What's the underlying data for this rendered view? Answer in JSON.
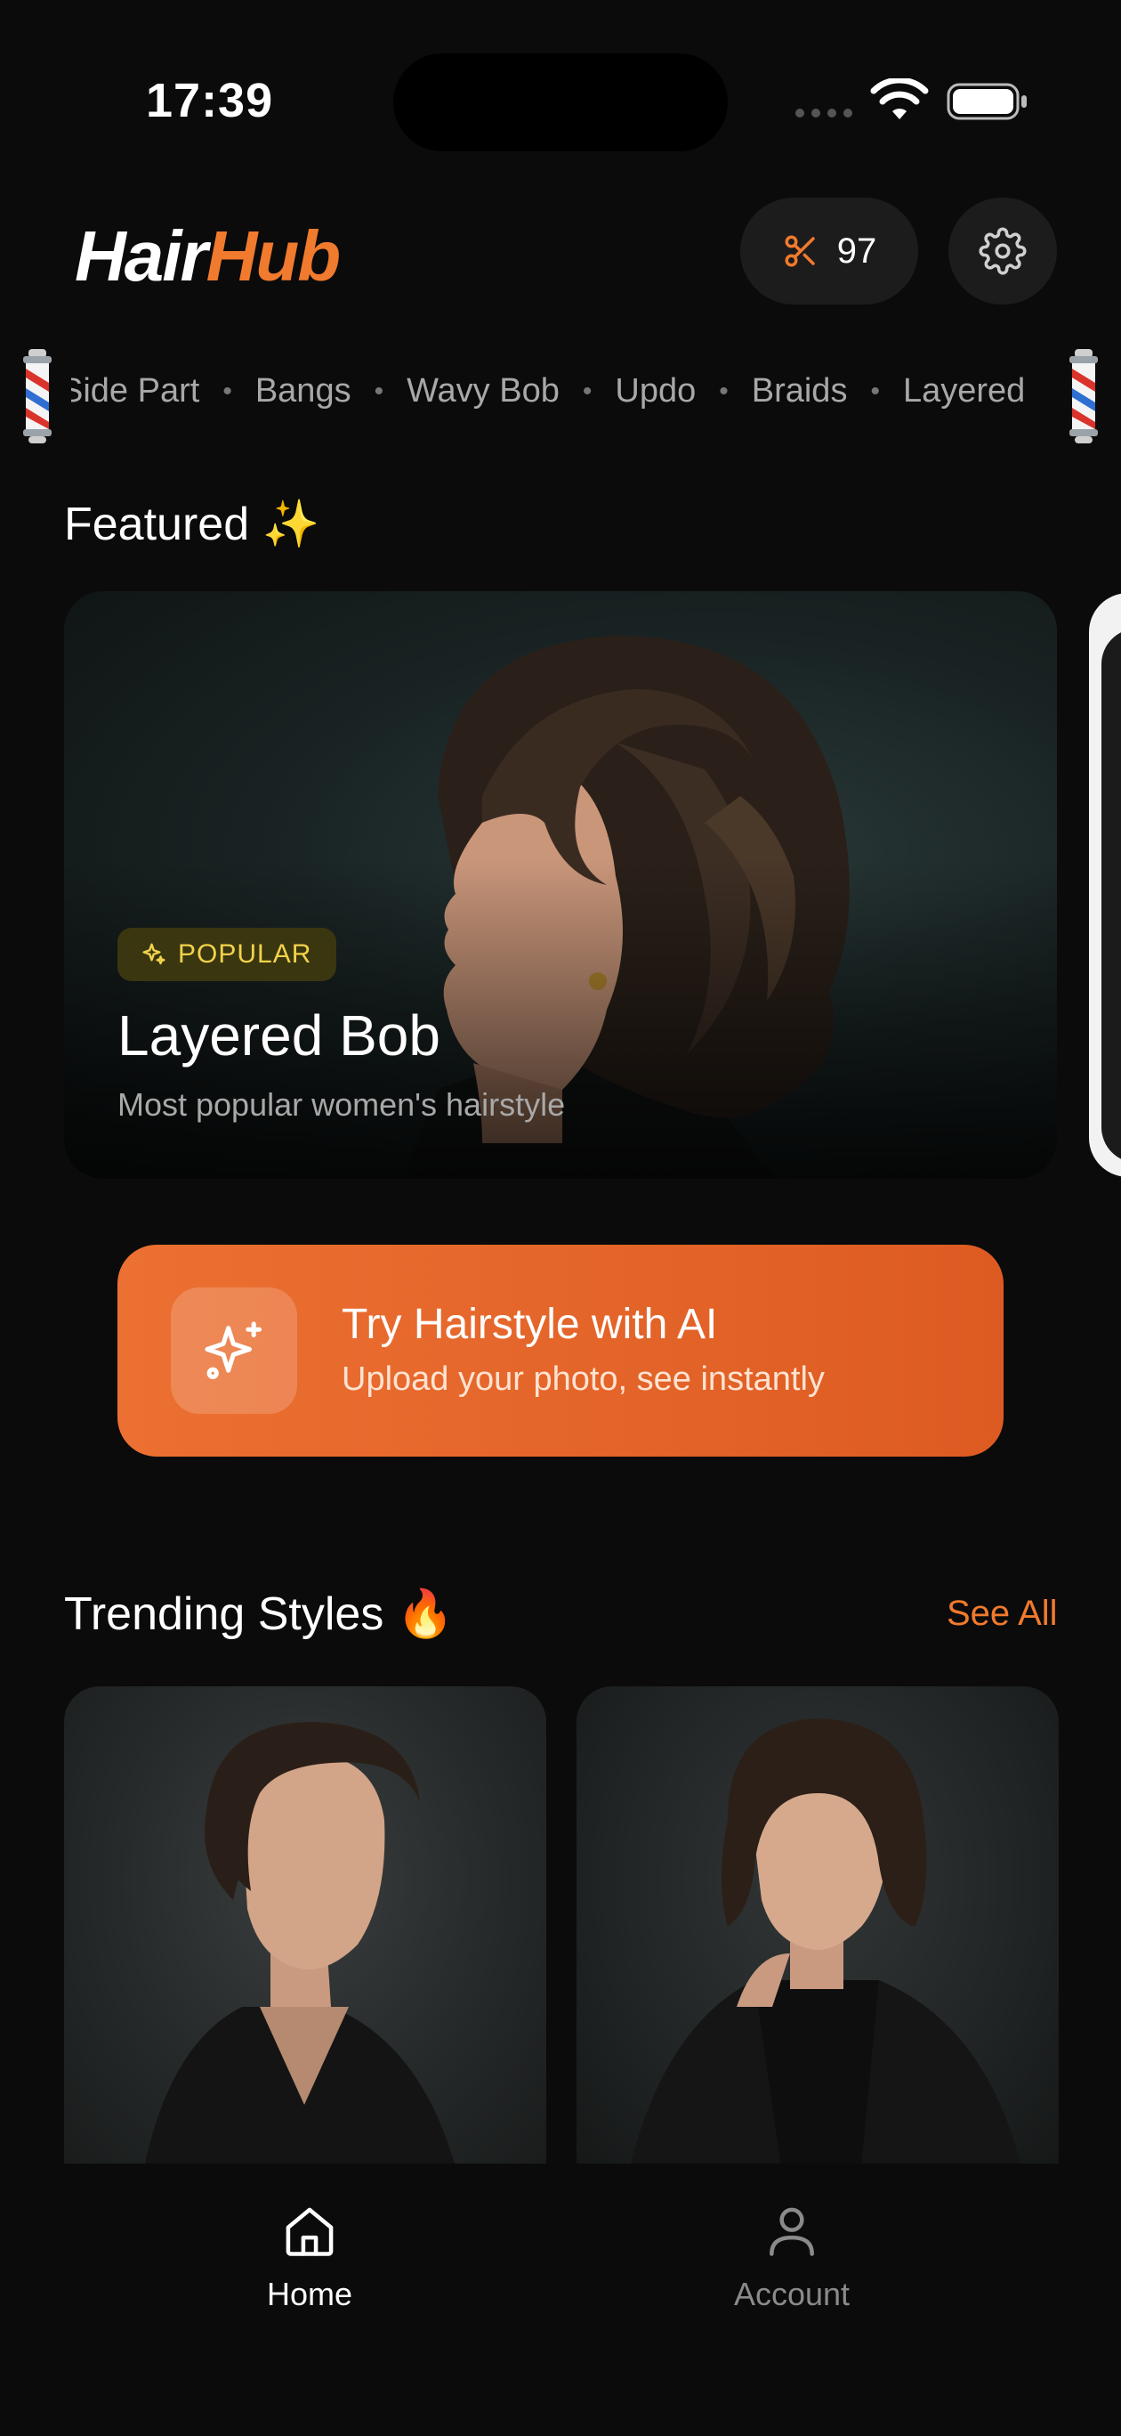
{
  "status_bar": {
    "time": "17:39"
  },
  "header": {
    "logo_part1": "Hair",
    "logo_part2": "Hub",
    "credits_count": "97",
    "accent_color": "#f07a2d"
  },
  "marquee": {
    "items": [
      "Side Part",
      "Bangs",
      "Wavy Bob",
      "Updo",
      "Braids",
      "Layered"
    ]
  },
  "featured": {
    "section_title": "Featured ✨",
    "badge_label": "POPULAR",
    "name": "Layered Bob",
    "subtitle": "Most popular women's hairstyle"
  },
  "ai_cta": {
    "title": "Try Hairstyle with AI",
    "subtitle": "Upload your photo, see instantly"
  },
  "trending": {
    "section_title": "Trending Styles 🔥",
    "see_all": "See All"
  },
  "bottom_nav": {
    "home": "Home",
    "account": "Account"
  },
  "icons": {
    "credits": "scissors-icon",
    "settings": "gear-icon",
    "badge": "sparkles-icon",
    "ai": "sparkles-icon",
    "home": "home-icon",
    "account": "user-icon"
  }
}
